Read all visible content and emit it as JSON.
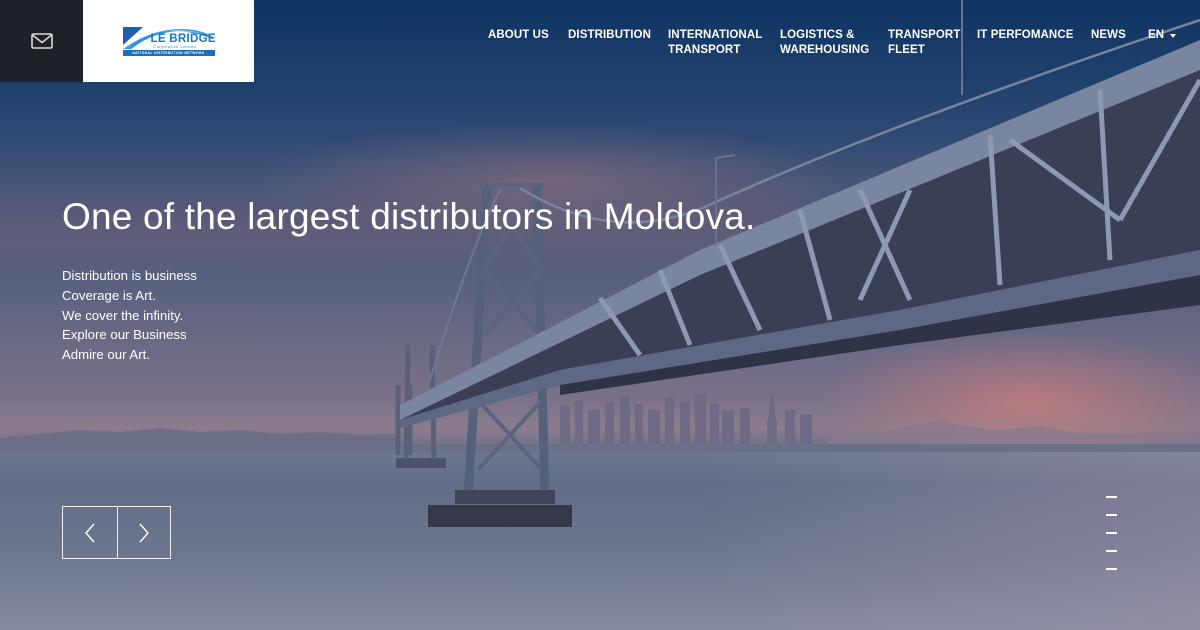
{
  "header": {
    "mail_icon": "envelope-icon",
    "logo": {
      "name": "LE BRIDGE",
      "subtitle": "Corporation Limited",
      "bar_text": "NATIONAL DISTRIBUTION NETWORK",
      "brand_color": "#1b77c2"
    },
    "nav": [
      {
        "label": "ABOUT US",
        "line2": ""
      },
      {
        "label": "DISTRIBUTION",
        "line2": ""
      },
      {
        "label": "INTERNATIONAL",
        "line2": "TRANSPORT"
      },
      {
        "label": "LOGISTICS &",
        "line2": "WAREHOUSING"
      },
      {
        "label": "TRANSPORT",
        "line2": "FLEET"
      },
      {
        "label": "IT PERFOMANCE",
        "line2": ""
      },
      {
        "label": "NEWS",
        "line2": ""
      }
    ],
    "language": {
      "selected": "EN",
      "icon": "caret-down-icon"
    }
  },
  "hero": {
    "headline": "One of the largest distributors in Moldova.",
    "tagline": [
      "Distribution is business",
      "Coverage is Art.",
      "We cover the infinity.",
      "Explore our Business",
      "Admire our Art."
    ]
  },
  "slider": {
    "prev_icon": "chevron-left-icon",
    "next_icon": "chevron-right-icon",
    "slide_count": 5
  }
}
